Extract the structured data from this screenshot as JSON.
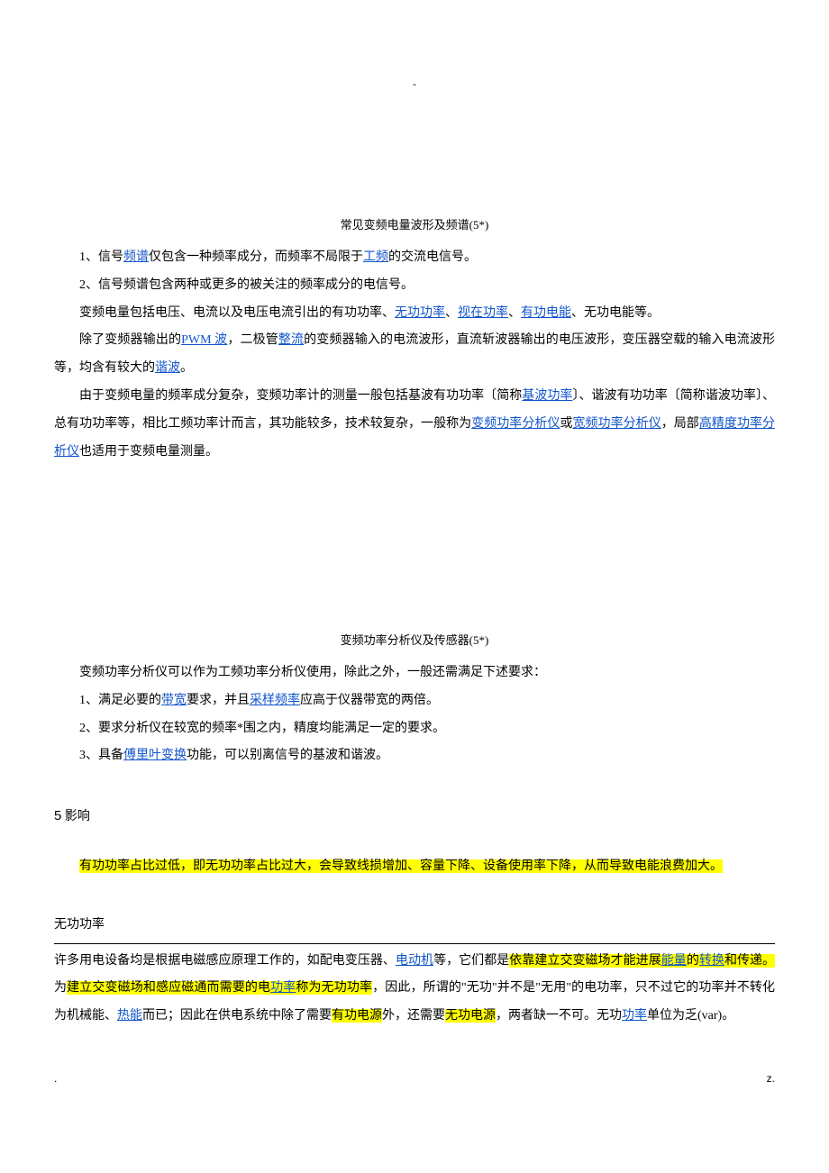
{
  "topmark": "-",
  "fig1_caption": "常见变频电量波形及频谱(5*)",
  "p1a": "1、信号",
  "p1_link1": "频谱",
  "p1b": "仅包含一种频率成分，而频率不局限于",
  "p1_link2": "工频",
  "p1c": "的交流电信号。",
  "p2": "2、信号频谱包含两种或更多的被关注的频率成分的电信号。",
  "p3a": "变频电量包括电压、电流以及电压电流引出的有功功率、",
  "p3_link1": "无功功率",
  "p3_sep": "、",
  "p3_link2": "视在功率",
  "p3_link3": "有功电能",
  "p3b": "、无功电能等。",
  "p4a": "除了变频器输出的",
  "p4_link1": "PWM 波",
  "p4b": "，二极管",
  "p4_link2": "整流",
  "p4c": "的变频器输入的电流波形，直流斩波器输出的电压波形，变压器空载的输入电流波形等，均含有较大的",
  "p4_link3": "谐波",
  "p4d": "。",
  "p5a": "由于变频电量的频率成分复杂，变频功率计的测量一般包括基波有功功率〔简称",
  "p5_link1": "基波功率",
  "p5b": "〕、谐波有功功率〔简称谐波功率〕、总有功功率等，相比工频功率计而言，其功能较多，技术较复杂，一般称为",
  "p5_link2": "变频功率分析仪",
  "p5c": "或",
  "p5_link3": "宽频功率分析仪",
  "p5d": "，局部",
  "p5_link4": "高精度功率分析仪",
  "p5e": "也适用于变频电量测量。",
  "fig2_caption": "变频功率分析仪及传感器(5*)",
  "q0": "变频功率分析仪可以作为工频功率分析仪使用，除此之外，一般还需满足下述要求：",
  "q1a": "1、满足必要的",
  "q1_link1": "带宽",
  "q1b": "要求，并且",
  "q1_link2": "采样频率",
  "q1c": "应高于仪器带宽的两倍。",
  "q2": "2、要求分析仪在较宽的频率*围之内，精度均能满足一定的要求。",
  "q3a": "3、具备",
  "q3_link1": "傅里叶变换",
  "q3b": "功能，可以别离信号的基波和谐波。",
  "sec5num": "5",
  "sec5title": "影响",
  "impact_a": "有功功率占比过低，即无功功率占比过大，会导致线损增加、容量下降、设备使用率下降，从而导致电能浪费加大。",
  "reactive_title": "无功功率",
  "r1a": "许多用电设备均是根据电磁感应原理工作的，如配电变压器、",
  "r1_link1": "电动机",
  "r1b": "等，它们都是",
  "r1_hl1": "依靠建立交变磁场才能进展",
  "r1_link_hl": "能量",
  "r1_hl1b": "的",
  "r1_link_hl2": "转换",
  "r1_hl1c": "和传递。",
  "r1c": "为",
  "r1_hl2": "建立交变磁场和感应磁通而需要的电",
  "r1_link2": "功率",
  "r1_hl2b": "称为无功功率",
  "r1d": "，因此，所谓的\"无功\"并不是\"无用\"的电功率，只不过它的功率并不转化为机械能、",
  "r1_link3": "热能",
  "r1e": "而已；因此在供电系统中除了需要",
  "r1_hl3": "有功电源",
  "r1f": "外，还需要",
  "r1_hl4": "无功电源",
  "r1g": "，两者缺一不可。无功",
  "r1_link4": "功率",
  "r1h": "单位为乏(var)。",
  "footL": ".",
  "footR": "z."
}
